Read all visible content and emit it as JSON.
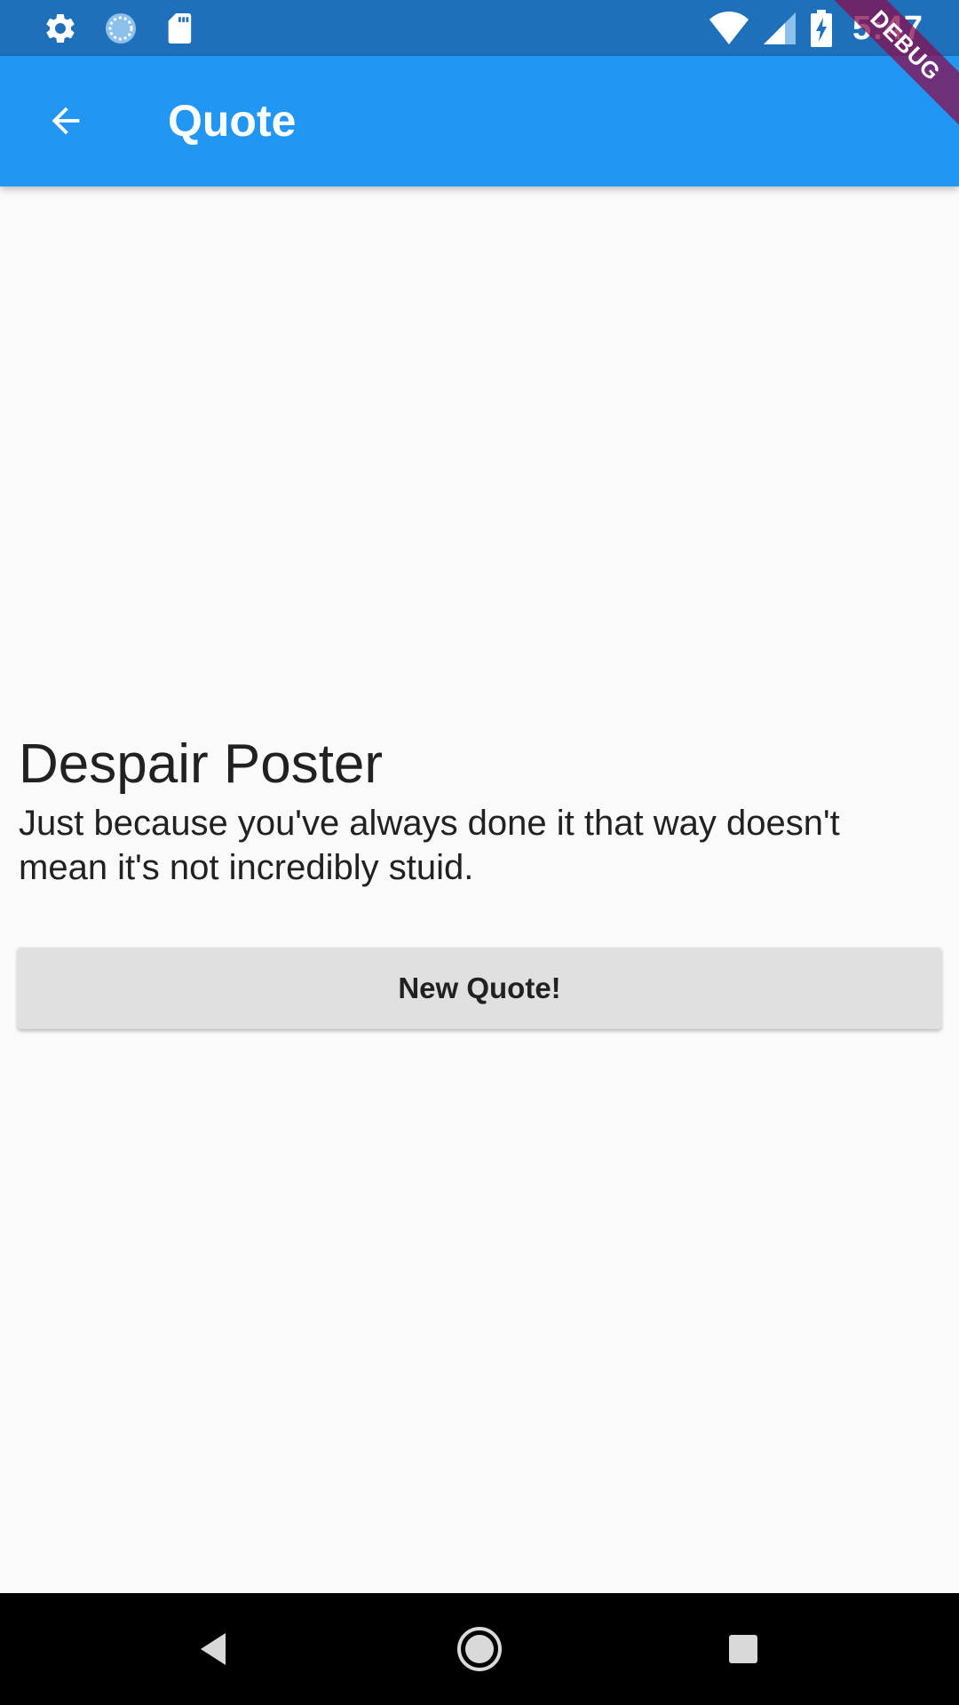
{
  "status_bar": {
    "time": "5:47",
    "left_icons": [
      "settings-icon",
      "sync-icon",
      "sd-card-icon"
    ],
    "right_icons": [
      "wifi-icon",
      "cell-signal-icon",
      "battery-charging-icon"
    ],
    "background": "#1e70bb"
  },
  "debug_banner": "DEBUG",
  "app_bar": {
    "title": "Quote",
    "back_icon": "arrow-back-icon",
    "background": "#2196f3"
  },
  "quote": {
    "title": "Despair Poster",
    "text": "Just because you've always done it that way doesn't mean it's not incredibly stuid."
  },
  "actions": {
    "new_quote_label": "New Quote!"
  },
  "nav_bar": {
    "icons": [
      "nav-back-icon",
      "nav-home-icon",
      "nav-recents-icon"
    ]
  }
}
